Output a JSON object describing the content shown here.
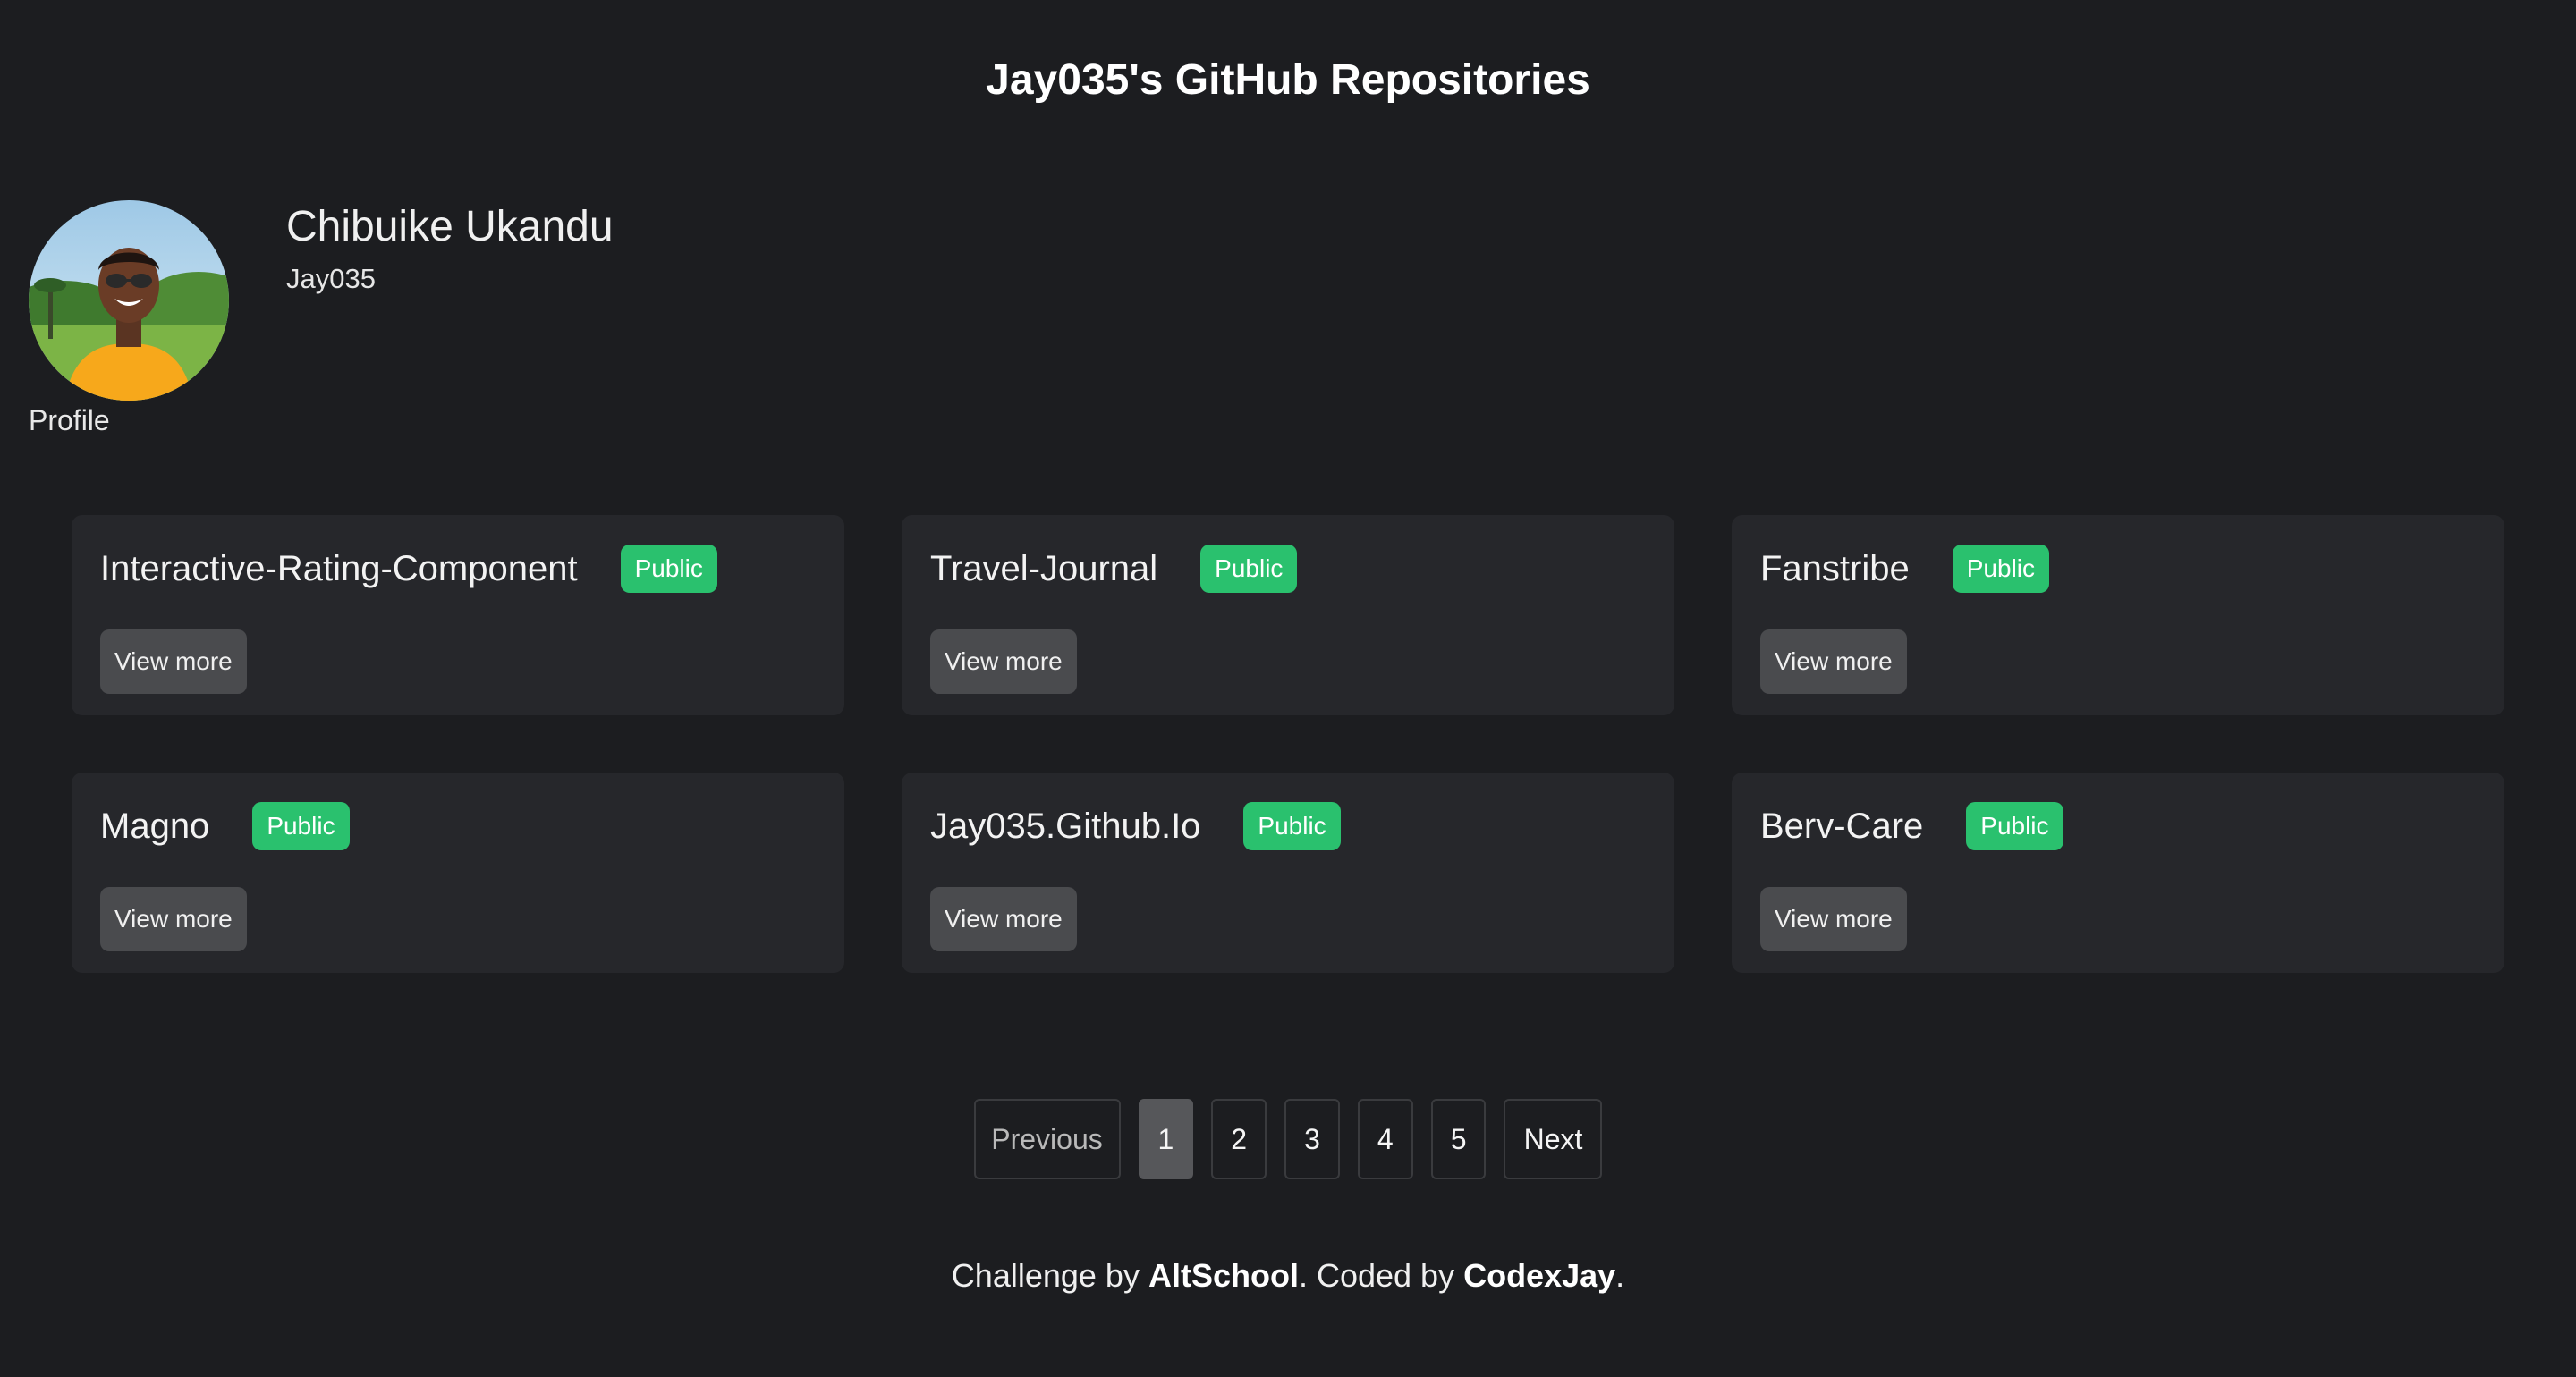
{
  "page": {
    "title": "Jay035's GitHub Repositories"
  },
  "profile": {
    "name": "Chibuike Ukandu",
    "username": "Jay035",
    "avatar_caption": "Profile"
  },
  "repos": [
    {
      "name": "Interactive-Rating-Component",
      "visibility": "Public",
      "action": "View more"
    },
    {
      "name": "Travel-Journal",
      "visibility": "Public",
      "action": "View more"
    },
    {
      "name": "Fanstribe",
      "visibility": "Public",
      "action": "View more"
    },
    {
      "name": "Magno",
      "visibility": "Public",
      "action": "View more"
    },
    {
      "name": "Jay035.Github.Io",
      "visibility": "Public",
      "action": "View more"
    },
    {
      "name": "Berv-Care",
      "visibility": "Public",
      "action": "View more"
    }
  ],
  "pagination": {
    "previous": "Previous",
    "pages": [
      "1",
      "2",
      "3",
      "4",
      "5"
    ],
    "current": "1",
    "next": "Next"
  },
  "footer": {
    "prefix": "Challenge by ",
    "org": "AltSchool",
    "middle": ". Coded by ",
    "author": "CodexJay",
    "suffix": "."
  },
  "colors": {
    "background": "#1c1d20",
    "card": "#26272b",
    "badge": "#2ac16e",
    "button": "#4a4b4e",
    "active_page": "#56575a"
  }
}
